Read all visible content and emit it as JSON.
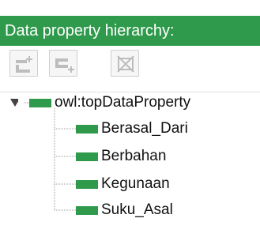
{
  "panel": {
    "title": "Data property hierarchy:",
    "accent": "#2f9a4c"
  },
  "toolbar": {
    "buttons": [
      {
        "name": "add-subproperty-button",
        "icon": "add-subproperty-icon"
      },
      {
        "name": "add-sibling-property-button",
        "icon": "add-sibling-property-icon"
      },
      {
        "name": "delete-property-button",
        "icon": "delete-property-icon"
      }
    ]
  },
  "tree": {
    "root": {
      "label": "owl:topDataProperty",
      "expanded": true
    },
    "children": [
      {
        "label": "Berasal_Dari"
      },
      {
        "label": "Berbahan"
      },
      {
        "label": "Kegunaan"
      },
      {
        "label": "Suku_Asal"
      }
    ]
  }
}
